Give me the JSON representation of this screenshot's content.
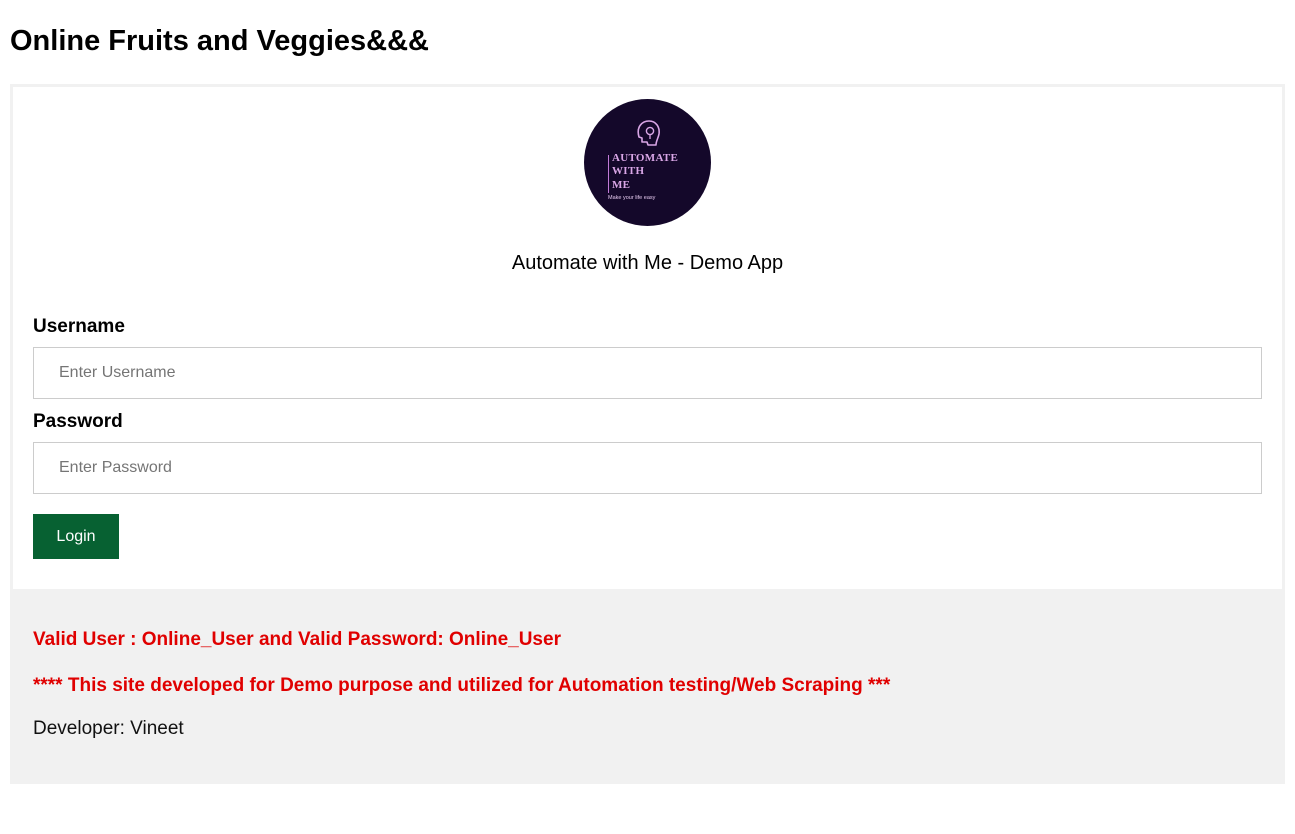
{
  "header": {
    "title": "Online Fruits and Veggies&&&"
  },
  "logo": {
    "icon": "head-gear-icon",
    "line1": "AUTOMATE",
    "line2": "WITH",
    "line3": "ME",
    "tagline": "Make your life easy",
    "background_color": "#14082a",
    "accent_color": "#d9a6e6"
  },
  "app": {
    "name": "Automate with Me - Demo App"
  },
  "form": {
    "username_label": "Username",
    "username_placeholder": "Enter Username",
    "username_value": "",
    "password_label": "Password",
    "password_placeholder": "Enter Password",
    "password_value": "",
    "login_label": "Login",
    "login_color": "#076132"
  },
  "footer": {
    "credentials_note": "Valid User : Online_User and Valid Password: Online_User",
    "demo_note": "**** This site developed for Demo purpose and utilized for Automation testing/Web Scraping ***",
    "developer": "Developer: Vineet",
    "note_color": "#e00000",
    "background_color": "#f1f1f1"
  }
}
